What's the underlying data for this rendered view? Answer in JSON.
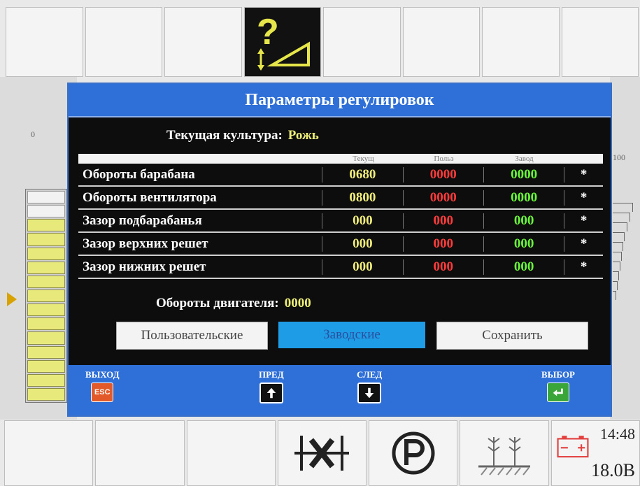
{
  "dialog": {
    "title": "Параметры регулировок",
    "crop_label": "Текущая культура:",
    "crop_value": "Рожь",
    "columns": [
      "Текущ",
      "Польз",
      "Завод",
      ""
    ],
    "rows": [
      {
        "name": "Обороты барабана",
        "current": "0680",
        "user": "0000",
        "factory": "0000",
        "mark": "*"
      },
      {
        "name": "Обороты вентилятора",
        "current": "0800",
        "user": "0000",
        "factory": "0000",
        "mark": "*"
      },
      {
        "name": "Зазор подбарабанья",
        "current": "000",
        "user": "000",
        "factory": "000",
        "mark": "*"
      },
      {
        "name": "Зазор верхних решет",
        "current": "000",
        "user": "000",
        "factory": "000",
        "mark": "*"
      },
      {
        "name": "Зазор нижних решет",
        "current": "000",
        "user": "000",
        "factory": "000",
        "mark": "*"
      }
    ],
    "engine_label": "Обороты двигателя:",
    "engine_value": "0000",
    "buttons": {
      "user": "Пользовательские",
      "factory": "Заводские",
      "save": "Сохранить"
    },
    "softkeys": {
      "exit_label": "ВЫХОД",
      "exit_key": "ESC",
      "prev_label": "ПРЕД",
      "next_label": "СЛЕД",
      "select_label": "ВЫБОР"
    }
  },
  "gauge": {
    "min_label": "0",
    "max_label": "100",
    "lit_segments": 13,
    "total_segments": 15
  },
  "status": {
    "time": "14:48",
    "voltage": "18.0B"
  },
  "colors": {
    "accent": "#2f6fd8",
    "current": "#f1ee7c",
    "user": "#ff3b3b",
    "factory": "#6bfa3a",
    "active_button": "#1e9de6"
  },
  "icons": [
    "adjust-help-icon",
    "diff-lock-icon",
    "parking-icon",
    "crop-field-icon",
    "battery-icon"
  ]
}
